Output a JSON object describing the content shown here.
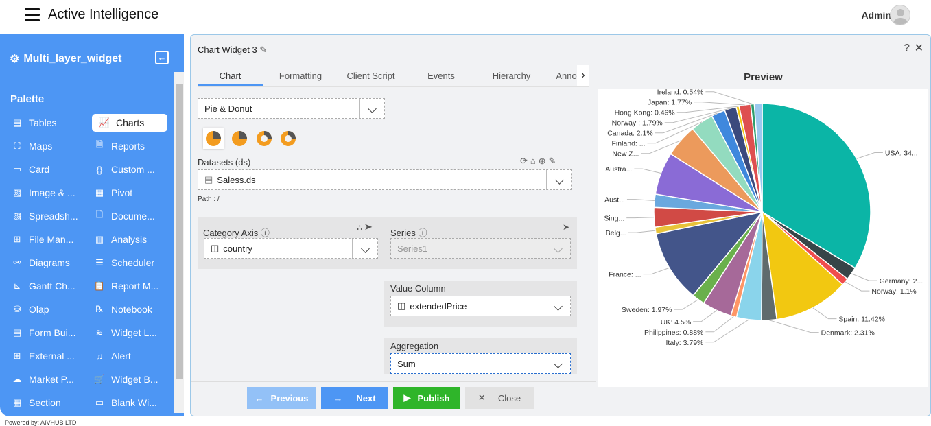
{
  "header": {
    "app_title": "Active Intelligence",
    "user": "Admin"
  },
  "sidebar": {
    "title": "Multi_layer_widget",
    "palette_label": "Palette",
    "items": [
      {
        "label": "Tables",
        "icon": "table-icon"
      },
      {
        "label": "Charts",
        "icon": "chart-icon",
        "active": true
      },
      {
        "label": "Maps",
        "icon": "map-icon"
      },
      {
        "label": "Reports",
        "icon": "report-icon"
      },
      {
        "label": "Card",
        "icon": "card-icon"
      },
      {
        "label": "Custom ...",
        "icon": "braces-icon"
      },
      {
        "label": "Image & ...",
        "icon": "image-icon"
      },
      {
        "label": "Pivot",
        "icon": "pivot-icon"
      },
      {
        "label": "Spreadsh...",
        "icon": "spreadsheet-icon"
      },
      {
        "label": "Docume...",
        "icon": "document-icon"
      },
      {
        "label": "File Man...",
        "icon": "file-manager-icon"
      },
      {
        "label": "Analysis",
        "icon": "analysis-icon"
      },
      {
        "label": "Diagrams",
        "icon": "diagram-icon"
      },
      {
        "label": "Scheduler",
        "icon": "scheduler-icon"
      },
      {
        "label": "Gantt Ch...",
        "icon": "gantt-icon"
      },
      {
        "label": "Report M...",
        "icon": "clipboard-icon"
      },
      {
        "label": "Olap",
        "icon": "olap-icon"
      },
      {
        "label": "Notebook",
        "icon": "notebook-icon"
      },
      {
        "label": "Form Bui...",
        "icon": "form-icon"
      },
      {
        "label": "Widget L...",
        "icon": "layers-icon"
      },
      {
        "label": "External ...",
        "icon": "external-icon"
      },
      {
        "label": "Alert",
        "icon": "alert-icon"
      },
      {
        "label": "Market P...",
        "icon": "cloud-upload-icon"
      },
      {
        "label": "Widget B...",
        "icon": "cart-icon"
      },
      {
        "label": "Section",
        "icon": "section-icon"
      },
      {
        "label": "Blank Wi...",
        "icon": "blank-widget-icon"
      }
    ]
  },
  "footer": {
    "powered": "Powered by: AIVHUB LTD"
  },
  "widget": {
    "title": "Chart Widget 3",
    "tabs": [
      "Chart",
      "Formatting",
      "Client Script",
      "Events",
      "Hierarchy",
      "Anno"
    ],
    "chart_type": "Pie & Donut",
    "datasets_label": "Datasets (ds)",
    "dataset": "Saless.ds",
    "path": "Path : /",
    "category_label": "Category Axis",
    "category": "country",
    "series_label": "Series",
    "series": "Series1",
    "value_label": "Value Column",
    "value": "extendedPrice",
    "aggregation_label": "Aggregation",
    "aggregation": "Sum",
    "buttons": {
      "previous": "Previous",
      "next": "Next",
      "publish": "Publish",
      "close": "Close"
    }
  },
  "preview": {
    "title": "Preview"
  },
  "chart_data": {
    "type": "pie",
    "categories": [
      "USA",
      "Germany",
      "Norway",
      "Spain",
      "Denmark",
      "Italy",
      "Philippines",
      "UK",
      "Sweden",
      "France",
      "Belgium",
      "Singapore",
      "Austria",
      "Australia",
      "New Zealand",
      "Finland",
      "Canada",
      "Norway ",
      "Hong Kong",
      "Japan",
      "Ireland",
      ""
    ],
    "labels": [
      "USA: 34...",
      "Germany: 2...",
      "Norway: 1.1%",
      "Spain: 11.42%",
      "Denmark: 2.31%",
      "Italy: 3.79%",
      "Philippines: 0.88%",
      "UK: 4.5%",
      "Sweden: 1.97%",
      "France: ...",
      "Belg...",
      "Sing...",
      "Aust...",
      "Austra...",
      "New Z...",
      "Finland: ...",
      "Canada: 2.1%",
      "Norway : 1.79%",
      "Hong Kong: 0.46%",
      "Japan: 1.77%",
      "Ireland: 0.54%",
      ""
    ],
    "values": [
      34.4,
      2.0,
      1.1,
      11.42,
      2.31,
      3.79,
      0.88,
      4.5,
      1.97,
      11.0,
      1.0,
      3.0,
      2.0,
      6.5,
      5.0,
      3.5,
      2.1,
      1.79,
      0.46,
      1.77,
      0.54,
      1.2
    ],
    "colors": [
      "#0bb5a6",
      "#374548",
      "#f04d4d",
      "#f2c811",
      "#5f6b6d",
      "#8ad4eb",
      "#fe9666",
      "#a66999",
      "#6ab04c",
      "#43558a",
      "#e8c33a",
      "#d14a45",
      "#6aa8de",
      "#8a6bd6",
      "#ec9a5c",
      "#93dbbf",
      "#3f88dd",
      "#3b4a7d",
      "#f2c811",
      "#de5050",
      "#2e9e6e",
      "#9bc9ef"
    ]
  }
}
